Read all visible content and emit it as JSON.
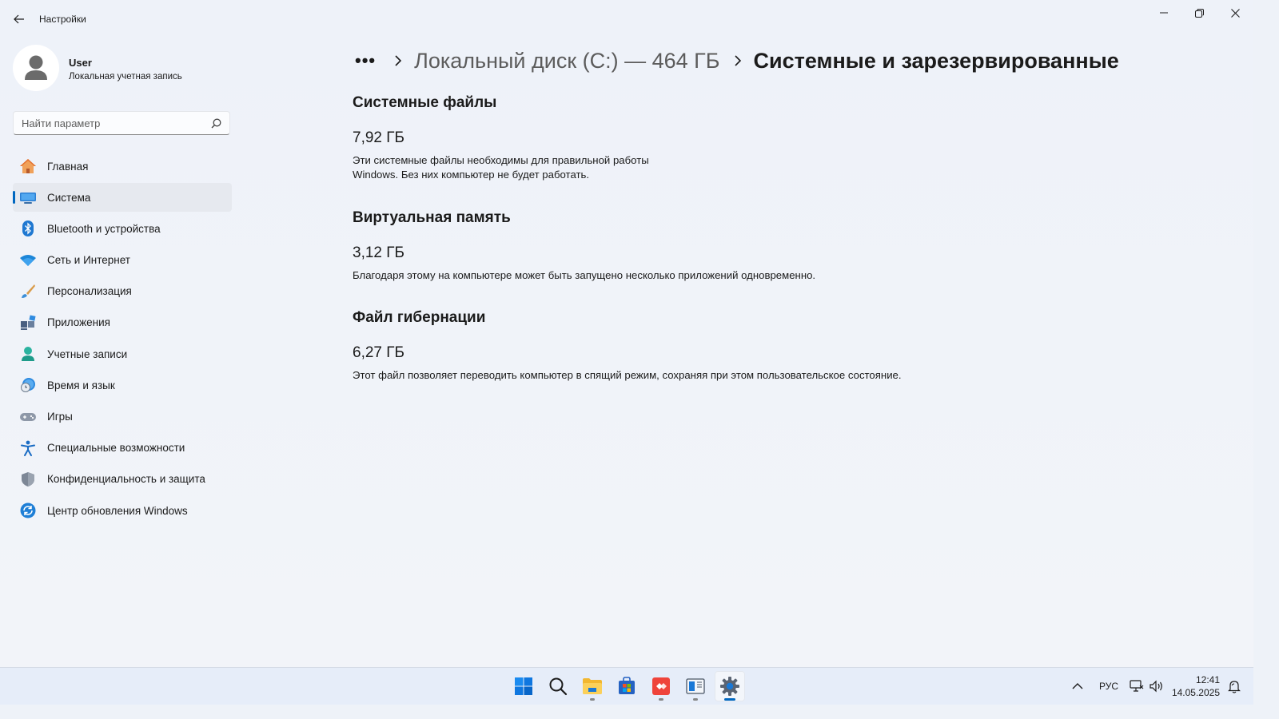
{
  "window": {
    "title": "Настройки"
  },
  "account": {
    "name": "User",
    "type": "Локальная учетная запись"
  },
  "search": {
    "placeholder": "Найти параметр"
  },
  "sidebar": {
    "items": [
      {
        "label": "Главная",
        "icon": "home-icon"
      },
      {
        "label": "Система",
        "icon": "system-icon",
        "selected": true
      },
      {
        "label": "Bluetooth и устройства",
        "icon": "bluetooth-icon"
      },
      {
        "label": "Сеть и Интернет",
        "icon": "wifi-icon"
      },
      {
        "label": "Персонализация",
        "icon": "brush-icon"
      },
      {
        "label": "Приложения",
        "icon": "apps-icon"
      },
      {
        "label": "Учетные записи",
        "icon": "account-icon"
      },
      {
        "label": "Время и язык",
        "icon": "time-language-icon"
      },
      {
        "label": "Игры",
        "icon": "gamepad-icon"
      },
      {
        "label": "Специальные возможности",
        "icon": "accessibility-icon"
      },
      {
        "label": "Конфиденциальность и защита",
        "icon": "shield-icon"
      },
      {
        "label": "Центр обновления Windows",
        "icon": "update-icon"
      }
    ]
  },
  "breadcrumb": {
    "more": "•••",
    "parent": "Локальный диск (C:) — 464 ГБ",
    "current": "Системные и зарезервированные"
  },
  "sections": [
    {
      "title": "Системные файлы",
      "size": "7,92 ГБ",
      "description_lines": [
        "Эти системные файлы необходимы для правильной работы",
        "Windows. Без них компьютер не будет работать."
      ]
    },
    {
      "title": "Виртуальная память",
      "size": "3,12 ГБ",
      "description_lines": [
        "Благодаря этому на компьютере может быть запущено несколько приложений одновременно."
      ]
    },
    {
      "title": "Файл гибернации",
      "size": "6,27 ГБ",
      "description_lines": [
        "Этот файл позволяет переводить компьютер в спящий режим, сохраняя при этом пользовательское состояние."
      ]
    }
  ],
  "taskbar": {
    "apps": [
      "start-icon",
      "search-icon",
      "file-explorer-icon",
      "store-icon",
      "anydesk-icon",
      "app-window-icon",
      "settings-icon"
    ],
    "language": "РУС",
    "time": "12:41",
    "date": "14.05.2025"
  },
  "colors": {
    "accent": "#0067c0",
    "background": "#eef2f8"
  }
}
